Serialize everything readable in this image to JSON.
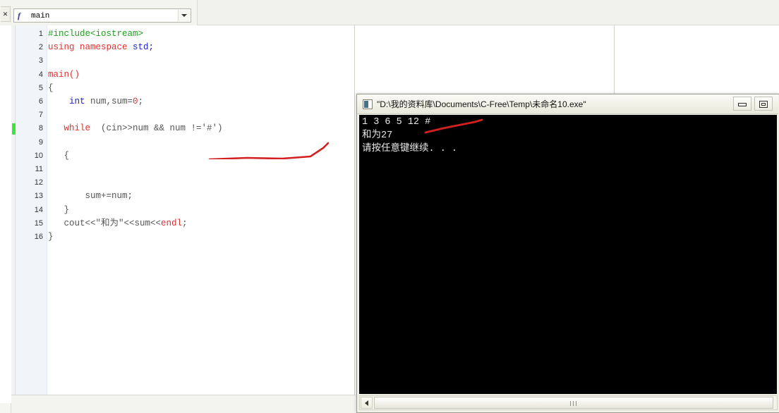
{
  "ide": {
    "panel_close_icon": "panel-close-icon",
    "function_combo": {
      "icon": "function-icon",
      "value": "main",
      "arrow_icon": "chevron-down-icon"
    }
  },
  "editor": {
    "execution_marker_line": 8,
    "lines": [
      {
        "no": "1",
        "tokens": [
          {
            "t": "#include<iostream>",
            "c": "t-pre"
          }
        ]
      },
      {
        "no": "2",
        "tokens": [
          {
            "t": "using namespace ",
            "c": "t-kw"
          },
          {
            "t": "std;",
            "c": "t-type"
          }
        ]
      },
      {
        "no": "3",
        "tokens": []
      },
      {
        "no": "4",
        "tokens": [
          {
            "t": "main()",
            "c": "t-kw"
          }
        ]
      },
      {
        "no": "5",
        "tokens": [
          {
            "t": "{",
            "c": "t-plain"
          }
        ]
      },
      {
        "no": "6",
        "tokens": [
          {
            "t": "    ",
            "c": "t-plain"
          },
          {
            "t": "int ",
            "c": "t-type"
          },
          {
            "t": "num,sum=",
            "c": "t-plain"
          },
          {
            "t": "0",
            "c": "t-num"
          },
          {
            "t": ";",
            "c": "t-plain"
          }
        ]
      },
      {
        "no": "7",
        "tokens": []
      },
      {
        "no": "8",
        "tokens": [
          {
            "t": "   ",
            "c": "t-plain"
          },
          {
            "t": "while",
            "c": "t-kw"
          },
          {
            "t": "  (cin>>num && num !='#')",
            "c": "t-plain"
          }
        ]
      },
      {
        "no": "9",
        "tokens": []
      },
      {
        "no": "10",
        "tokens": [
          {
            "t": "   {",
            "c": "t-plain"
          }
        ]
      },
      {
        "no": "11",
        "tokens": []
      },
      {
        "no": "12",
        "tokens": []
      },
      {
        "no": "13",
        "tokens": [
          {
            "t": "       sum+=num;",
            "c": "t-plain"
          }
        ]
      },
      {
        "no": "14",
        "tokens": [
          {
            "t": "   }",
            "c": "t-plain"
          }
        ]
      },
      {
        "no": "15",
        "tokens": [
          {
            "t": "   cout<<\"和为\"<<sum<<",
            "c": "t-plain"
          },
          {
            "t": "endl",
            "c": "t-kw"
          },
          {
            "t": ";",
            "c": "t-plain"
          }
        ]
      },
      {
        "no": "16",
        "tokens": [
          {
            "t": "}",
            "c": "t-plain"
          }
        ]
      }
    ]
  },
  "console": {
    "app_icon": "console-app-icon",
    "title": "\"D:\\我的资料库\\Documents\\C-Free\\Temp\\未命名10.exe\"",
    "minimize_icon": "minimize-icon",
    "restore_icon": "restore-icon",
    "output_lines": [
      "1 3 6 5 12 #",
      "和为27",
      "请按任意键继续. . ."
    ],
    "scrollbar": {
      "left_arrow_icon": "scroll-left-arrow-icon",
      "thumb": "scrollbar-thumb"
    }
  },
  "annotations": {
    "color": "#d42020",
    "marks": [
      {
        "name": "annotation-underline-code",
        "desc": "red hand-drawn line under while condition"
      },
      {
        "name": "annotation-underline-console",
        "desc": "red hand-drawn line under console input line"
      }
    ]
  },
  "colors": {
    "preprocessor": "#1f9e1f",
    "keyword": "#e03030",
    "type": "#2020cf",
    "number": "#e03030",
    "plain": "#555555",
    "marker_green": "#3ee33e",
    "annotation_red": "#d42020"
  }
}
